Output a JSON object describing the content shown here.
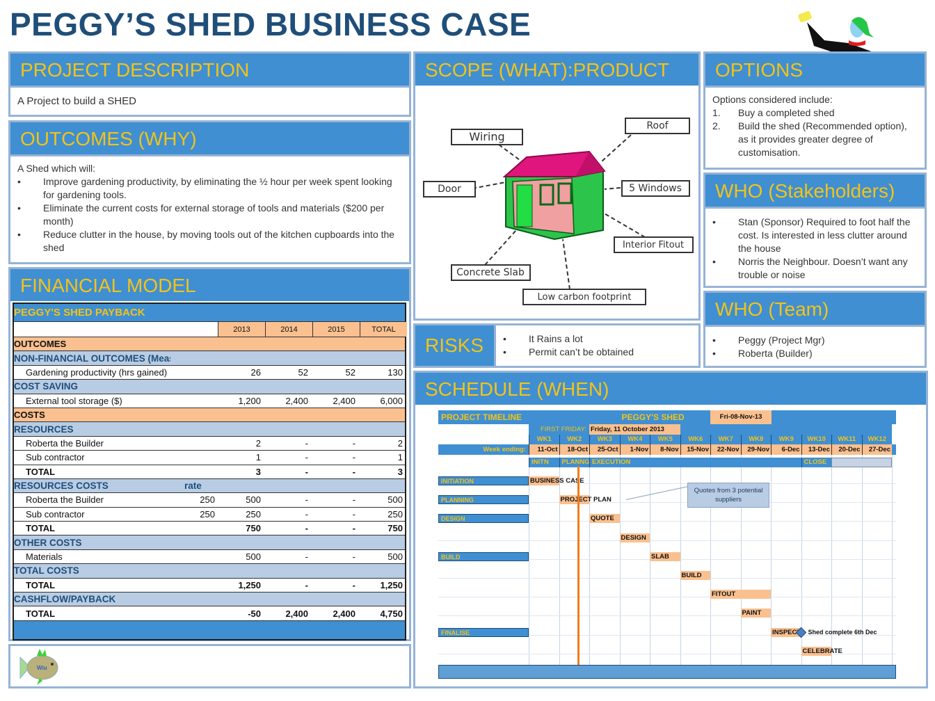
{
  "page": {
    "title": "PEGGY’S SHED BUSINESS CASE"
  },
  "project_description": {
    "heading": "PROJECT DESCRIPTION",
    "text": "A Project to build a SHED"
  },
  "outcomes": {
    "heading": "OUTCOMES (WHY)",
    "intro": "A Shed which will:",
    "items": [
      "Improve gardening productivity, by eliminating the ½ hour per week spent looking for gardening tools.",
      "Eliminate the current costs for external storage of tools and materials ($200 per month)",
      "Reduce clutter in the house, by moving tools out of the kitchen cupboards into the shed"
    ]
  },
  "financial_model": {
    "heading": "FINANCIAL MODEL",
    "table_title": "PEGGY'S SHED PAYBACK",
    "columns": [
      "2013",
      "2014",
      "2015",
      "TOTAL"
    ],
    "rows": [
      {
        "type": "sec-orange",
        "label": "OUTCOMES"
      },
      {
        "type": "sec-blue",
        "label": "NON-FINANCIAL OUTCOMES (Measurable)"
      },
      {
        "type": "data",
        "label": "Gardening productivity (hrs gained)",
        "rate": "",
        "values": [
          "26",
          "52",
          "52",
          "130"
        ]
      },
      {
        "type": "sec-blue",
        "label": "COST SAVING"
      },
      {
        "type": "data",
        "label": "External tool storage ($)",
        "rate": "",
        "values": [
          "1,200",
          "2,400",
          "2,400",
          "6,000"
        ]
      },
      {
        "type": "sec-orange",
        "label": "COSTS"
      },
      {
        "type": "sec-blue",
        "label": "RESOURCES"
      },
      {
        "type": "data",
        "label": "Roberta the Builder",
        "rate": "",
        "values": [
          "2",
          "-",
          "-",
          "2"
        ]
      },
      {
        "type": "data",
        "label": "Sub contractor",
        "rate": "",
        "values": [
          "1",
          "-",
          "-",
          "1"
        ]
      },
      {
        "type": "data bold",
        "label": "TOTAL",
        "rate": "",
        "values": [
          "3",
          "-",
          "-",
          "3"
        ]
      },
      {
        "type": "sec-blue",
        "label": "RESOURCES COSTS",
        "rate_label": "rate"
      },
      {
        "type": "data",
        "label": "Roberta the Builder",
        "rate": "250",
        "values": [
          "500",
          "-",
          "-",
          "500"
        ]
      },
      {
        "type": "data",
        "label": "Sub contractor",
        "rate": "250",
        "values": [
          "250",
          "-",
          "-",
          "250"
        ]
      },
      {
        "type": "data bold",
        "label": "TOTAL",
        "rate": "",
        "values": [
          "750",
          "-",
          "-",
          "750"
        ]
      },
      {
        "type": "sec-blue",
        "label": "OTHER COSTS"
      },
      {
        "type": "data",
        "label": "Materials",
        "rate": "",
        "values": [
          "500",
          "-",
          "-",
          "500"
        ]
      },
      {
        "type": "sec-blue",
        "label": "TOTAL COSTS"
      },
      {
        "type": "data bold",
        "label": "TOTAL",
        "rate": "",
        "values": [
          "1,250",
          "-",
          "-",
          "1,250"
        ]
      },
      {
        "type": "sec-blue",
        "label": "CASHFLOW/PAYBACK"
      },
      {
        "type": "data bold",
        "label": "TOTAL",
        "rate": "",
        "values": [
          "-50",
          "2,400",
          "2,400",
          "4,750"
        ]
      }
    ]
  },
  "scope": {
    "heading": "SCOPE (WHAT):PRODUCT",
    "labels": [
      "Wiring",
      "Roof",
      "Door",
      "5 Windows",
      "Interior Fitout",
      "Concrete Slab",
      "Low carbon footprint"
    ]
  },
  "risks": {
    "heading": "RISKS",
    "items": [
      "It Rains a lot",
      "Permit can’t be obtained"
    ]
  },
  "options": {
    "heading": "OPTIONS",
    "intro": "Options considered include:",
    "items": [
      {
        "n": "1.",
        "text": "Buy a completed shed"
      },
      {
        "n": "2.",
        "text": "Build the shed (Recommended option), as it provides greater degree of customisation."
      }
    ]
  },
  "stakeholders": {
    "heading": "WHO (Stakeholders)",
    "items": [
      "Stan (Sponsor) Required to foot half the cost.  Is interested in less clutter around the house",
      "Norris the Neighbour.  Doesn’t want any trouble or noise"
    ]
  },
  "team": {
    "heading": "WHO (Team)",
    "items": [
      "Peggy (Project Mgr)",
      "Roberta (Builder)"
    ]
  },
  "schedule": {
    "heading": "SCHEDULE (WHEN)",
    "timeline_title": "PROJECT TIMELINE",
    "project_name": "PEGGY'S SHED",
    "status_date": "Fri-08-Nov-13",
    "first_friday_label": "FIRST FRIDAY:",
    "first_friday_value": "Friday, 11 October 2013",
    "week_ending_label": "Week ending:",
    "weeks": [
      "WK1",
      "WK2",
      "WK3",
      "WK4",
      "WK5",
      "WK6",
      "WK7",
      "WK8",
      "WK9",
      "WK10",
      "WK11",
      "WK12"
    ],
    "week_dates": [
      "11-Oct",
      "18-Oct",
      "25-Oct",
      "1-Nov",
      "8-Nov",
      "15-Nov",
      "22-Nov",
      "29-Nov",
      "6-Dec",
      "13-Dec",
      "20-Dec",
      "27-Dec"
    ],
    "phases": [
      {
        "label": "INITN",
        "start": 0,
        "span": 1
      },
      {
        "label": "PLANNG",
        "start": 1,
        "span": 1
      },
      {
        "label": "EXECUTION",
        "start": 2,
        "span": 7
      },
      {
        "label": "CLOSE",
        "start": 9,
        "span": 1
      }
    ],
    "stages": [
      {
        "label": "INITIATION",
        "row": 0
      },
      {
        "label": "PLANNING",
        "row": 1
      },
      {
        "label": "DESIGN",
        "row": 2
      },
      {
        "label": "BUILD",
        "row": 4
      },
      {
        "label": "FINALISE",
        "row": 8
      }
    ],
    "tasks": [
      {
        "label": "BUSINESS CASE",
        "row": 0,
        "start": 0,
        "span": 1
      },
      {
        "label": "PROJECT PLAN",
        "row": 1,
        "start": 1,
        "span": 1
      },
      {
        "label": "QUOTE",
        "row": 2,
        "start": 2,
        "span": 1
      },
      {
        "label": "DESIGN",
        "row": 3,
        "start": 3,
        "span": 1
      },
      {
        "label": "SLAB",
        "row": 4,
        "start": 4,
        "span": 1
      },
      {
        "label": "BUILD",
        "row": 5,
        "start": 5,
        "span": 1
      },
      {
        "label": "FITOUT",
        "row": 6,
        "start": 6,
        "span": 2
      },
      {
        "label": "PAINT",
        "row": 7,
        "start": 7,
        "span": 1
      },
      {
        "label": "INSPECT",
        "row": 8,
        "start": 8,
        "span": 1
      },
      {
        "label": "CELEBRATE",
        "row": 9,
        "start": 9,
        "span": 1
      }
    ],
    "milestone": {
      "label": "Shed complete 6th Dec",
      "row": 8,
      "at_week": 9
    },
    "callout": "Quotes from 3 potential suppliers",
    "today_marker_week": 1.6,
    "colors": {
      "blue": "#3f8fd2",
      "orange": "#fac08f",
      "yellow": "#f2c318",
      "today": "#f07c1a"
    }
  }
}
